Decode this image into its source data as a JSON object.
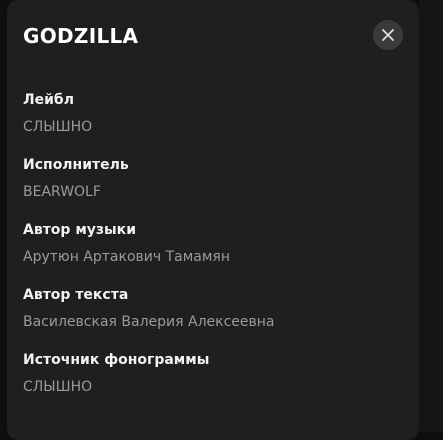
{
  "dialog": {
    "title": "GODZILLA",
    "close_icon": "close-icon",
    "fields": [
      {
        "label": "Лейбл",
        "value": "СЛЫШНО"
      },
      {
        "label": "Исполнитель",
        "value": "BEARWOLF"
      },
      {
        "label": "Автор музыки",
        "value": "Арутюн Артакович Тамамян"
      },
      {
        "label": "Автор текста",
        "value": "Василевская Валерия Алексеевна"
      },
      {
        "label": "Источник фонограммы",
        "value": "СЛЫШНО"
      }
    ]
  },
  "colors": {
    "panel_bg": "#1f1f1f",
    "label": "#f2f2f2",
    "value": "#9a9a9a",
    "close_bg": "#3a3a3a"
  }
}
